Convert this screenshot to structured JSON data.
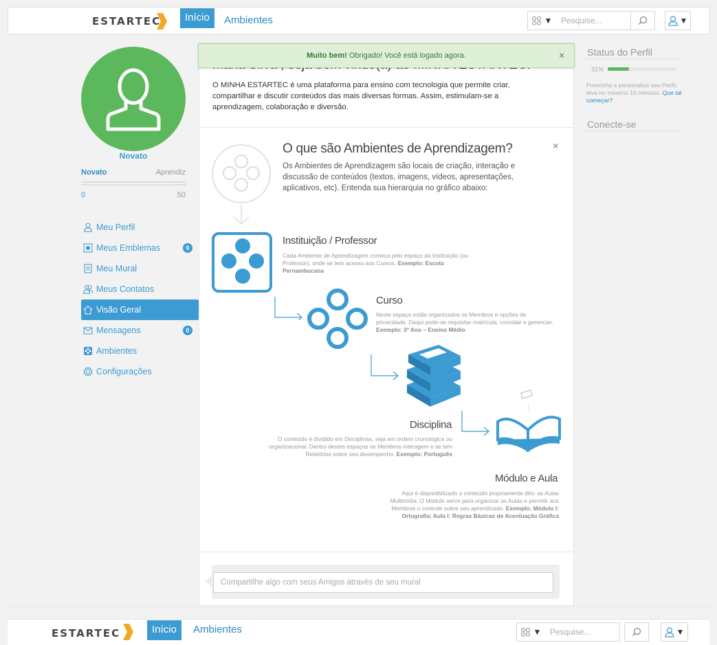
{
  "nav": {
    "logo": "ESTARTEC",
    "links": [
      "Início",
      "Ambientes"
    ],
    "search_placeholder": "Pesquise..."
  },
  "flash": {
    "strong": "Muito bem!",
    "text": " Obrigado! Você está logado agora.",
    "close": "×"
  },
  "profile": {
    "level": "Novato",
    "level_from": "Novato",
    "level_to": "Aprendiz",
    "points_from": "0",
    "points_to": "50"
  },
  "menu": [
    {
      "label": "Meu Perfil"
    },
    {
      "label": "Meus Emblemas",
      "badge": "0"
    },
    {
      "label": "Meu Mural"
    },
    {
      "label": "Meus Contatos"
    },
    {
      "label": "Visão Geral"
    },
    {
      "label": "Mensagens",
      "badge": "0"
    },
    {
      "label": "Ambientes"
    },
    {
      "label": "Configurações"
    }
  ],
  "welcome": {
    "title": "Maria Silva , seja bem vindo(a) ao MINHA ESTARTEC!",
    "text": "O MINHA ESTARTEC é uma plataforma para ensino com tecnologia que permite criar, compartilhar e discutir conteúdos das mais diversas formas. Assim, estimulam-se a aprendizagem, colaboração e diversão."
  },
  "intro": {
    "title": "O que são Ambientes de Aprendizagem?",
    "text": "Os Ambientes de Aprendizagem são locais de criação, interação e discussão de conteúdos (textos, imagens, vídeos, apresentações, aplicativos, etc). Entenda sua hierarquia no gráfico abaixo:",
    "close": "×"
  },
  "levels": {
    "institution": {
      "title": "Instituição / Professor",
      "desc": "Cada Ambiente de Aprendizagem começa pelo espaço da Instituição (ou Professor), onde se tem acesso aos Cursos.",
      "example_label": "Exemplo:",
      "example": "Escola Pernambucana"
    },
    "course": {
      "title": "Curso",
      "desc": "Neste espaço estão organizados os Membros e opções de privacidade. Daqui pode-se requisitar matrícula, convidar e gerenciar.",
      "example_label": "Exemplo:",
      "example": "3º Ano – Ensino Médio"
    },
    "discipline": {
      "title": "Disciplina",
      "desc": "O conteúdo é dividido em Disciplinas, seja em ordem cronológica ou organizacional. Dentro destes espaços os Membros interagem e se tem Relatórios sobre seu desempenho.",
      "example_label": "Exemplo:",
      "example": "Português"
    },
    "module": {
      "title": "Módulo e Aula",
      "desc": "Aqui é disponibilizado o conteúdo propriamente dito: as Aulas Multimídia. O Módulo serve para organizar as Aulas e permitir aos Membros o controle sobre seu aprendizado.",
      "example_label": "Exemplo:",
      "example": "Módulo I: Ortografia; Aula I: Regras Básicas de Acentuação Gráfica"
    }
  },
  "composer": {
    "placeholder": "Compartilhe algo com seus Amigos através de seu mural"
  },
  "status": {
    "title": "Status do Perfil",
    "percent": "31%",
    "percent_value": 31,
    "text": "Preencha e personalize seu Perfil; leva no máximo 10 minutos.",
    "link": "Que tal começar?",
    "connect_title": "Conecte-se"
  },
  "colors": {
    "brand_blue": "#3c9bd2",
    "success_green": "#5cb85c",
    "logo_orange": "#f5a623"
  }
}
